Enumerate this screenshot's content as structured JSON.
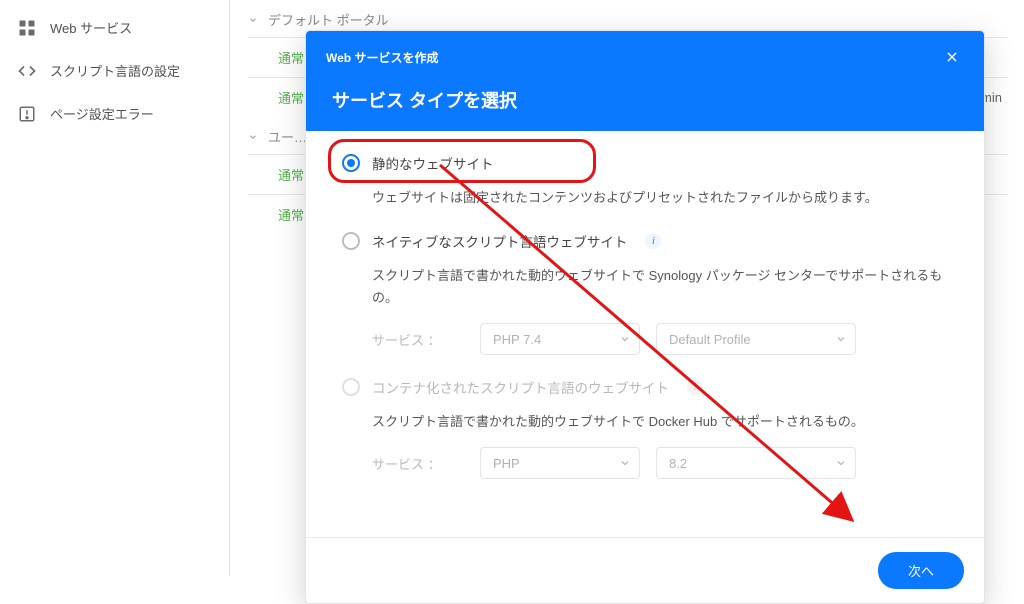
{
  "sidebar": {
    "items": [
      {
        "label": "Web サービス"
      },
      {
        "label": "スクリプト言語の設定"
      },
      {
        "label": "ページ設定エラー"
      }
    ]
  },
  "main": {
    "sections": [
      {
        "title": "デフォルト ポータル",
        "rows": [
          "通常",
          "通常"
        ]
      },
      {
        "title": "ユー…",
        "rows": [
          "通常",
          "通常"
        ]
      }
    ],
    "right_cell": "admin"
  },
  "modal": {
    "small_title": "Web サービスを作成",
    "big_title": "サービス タイプを選択",
    "opt_static": {
      "label": "静的なウェブサイト",
      "desc": "ウェブサイトは固定されたコンテンツおよびプリセットされたファイルから成ります。"
    },
    "opt_native": {
      "label": "ネイティブなスクリプト言語ウェブサイト",
      "desc": "スクリプト言語で書かれた動的ウェブサイトで Synology パッケージ センターでサポートされるもの。",
      "svc_label": "サービス ：",
      "select1": "PHP 7.4",
      "select2": "Default Profile"
    },
    "opt_container": {
      "label": "コンテナ化されたスクリプト言語のウェブサイト",
      "desc": "スクリプト言語で書かれた動的ウェブサイトで Docker Hub でサポートされるもの。",
      "svc_label": "サービス ：",
      "select1": "PHP",
      "select2": "8.2"
    },
    "next": "次へ"
  }
}
